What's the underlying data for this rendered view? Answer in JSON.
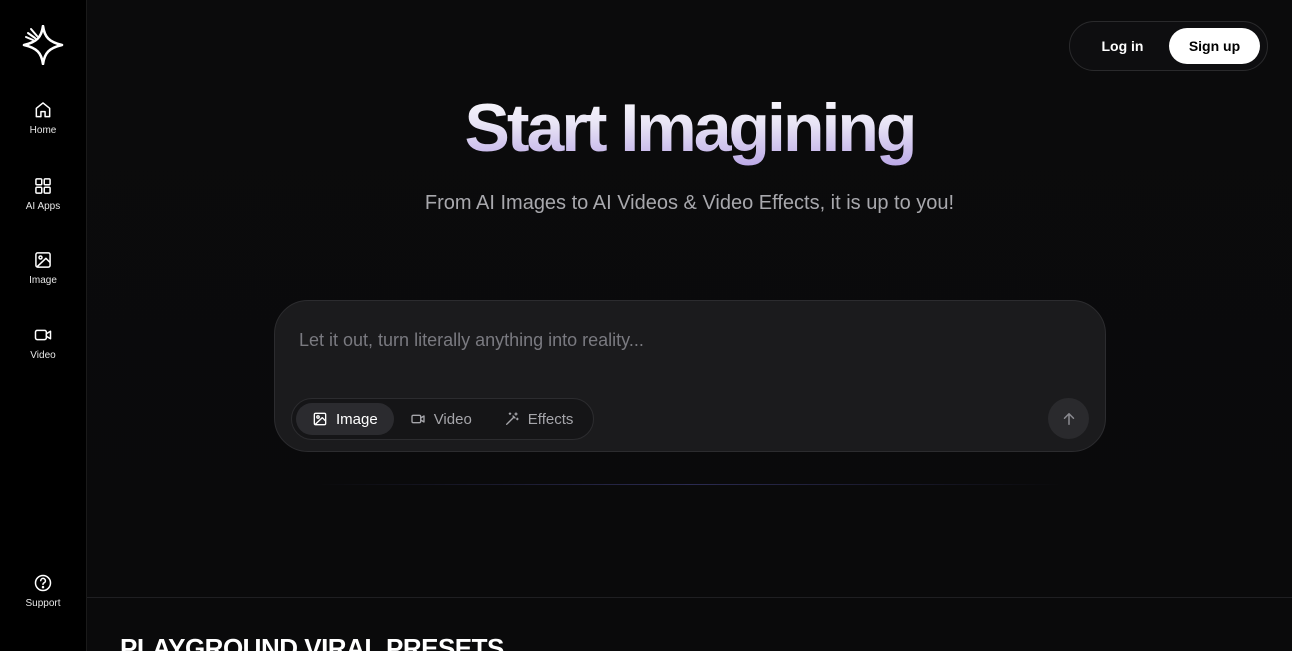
{
  "sidebar": {
    "items": [
      {
        "label": "Home",
        "icon": "home-icon"
      },
      {
        "label": "AI Apps",
        "icon": "grid-icon"
      },
      {
        "label": "Image",
        "icon": "image-icon"
      },
      {
        "label": "Video",
        "icon": "video-icon"
      }
    ],
    "support": {
      "label": "Support",
      "icon": "help-circle-icon"
    }
  },
  "header": {
    "login_label": "Log in",
    "signup_label": "Sign up"
  },
  "hero": {
    "title": "Start Imagining",
    "subtitle": "From AI Images to AI Videos & Video Effects, it is up to you!"
  },
  "prompt": {
    "placeholder": "Let it out, turn literally anything into reality...",
    "value": "",
    "tabs": [
      {
        "label": "Image",
        "icon": "image-icon",
        "active": true
      },
      {
        "label": "Video",
        "icon": "video-icon",
        "active": false
      },
      {
        "label": "Effects",
        "icon": "magic-wand-icon",
        "active": false
      }
    ]
  },
  "section": {
    "title": "PLAYGROUND VIRAL PRESETS"
  },
  "colors": {
    "background": "#0a0a0b",
    "card": "#1b1b1d",
    "accent_gradient_end": "#b9a6e6"
  }
}
